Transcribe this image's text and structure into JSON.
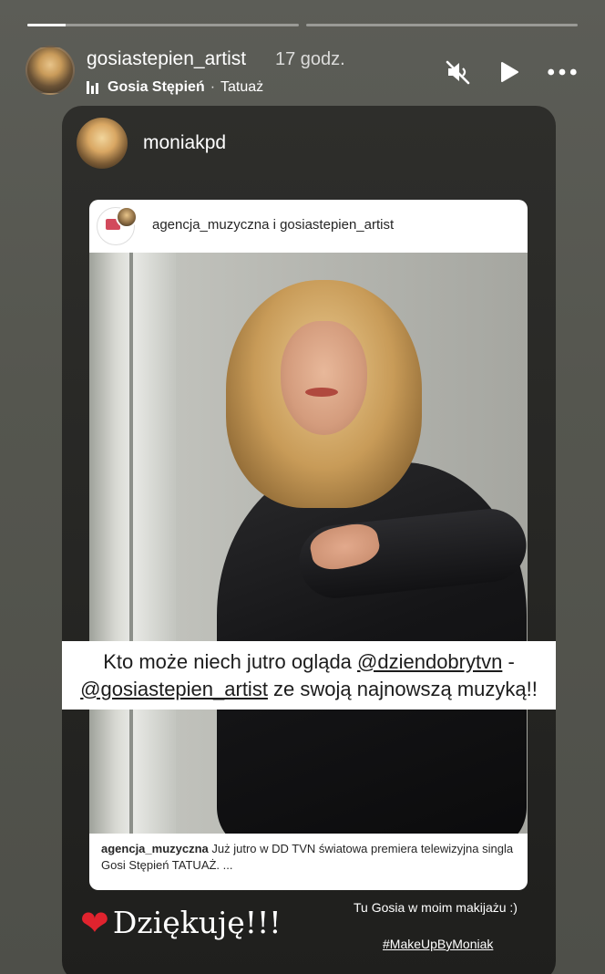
{
  "progress": [
    {
      "fill": 0.14
    },
    {
      "fill": 0.0
    }
  ],
  "header": {
    "username": "gosiastepien_artist",
    "time": "17 godz.",
    "music_artist": "Gosia Stępień",
    "music_separator": "·",
    "music_title": "Tatuaż",
    "icons": [
      "sound-muted-icon",
      "play-icon",
      "more-icon"
    ]
  },
  "card": {
    "username": "moniakpd"
  },
  "post": {
    "authors": "agencja_muzyczna i gosiastepien_artist",
    "caption_user": "agencja_muzyczna",
    "caption_text": "Już jutro w DD TVN światowa premiera telewizyjna singla Gosi Stępień TATUAŻ. ..."
  },
  "overlay": {
    "line1_prefix": "Kto może niech jutro ogląda ",
    "line1_mention": "@dziendobrytvn",
    "line1_suffix": " -",
    "line2_mention": "@gosiastepien_artist",
    "line2_suffix": " ze swoją najnowszą muzyką!!"
  },
  "bottom": {
    "heart": "❤",
    "thanks": "Dziękuję!!!",
    "note": "Tu Gosia w moim makijażu :)",
    "hashtag": "#MakeUpByMoniak"
  }
}
